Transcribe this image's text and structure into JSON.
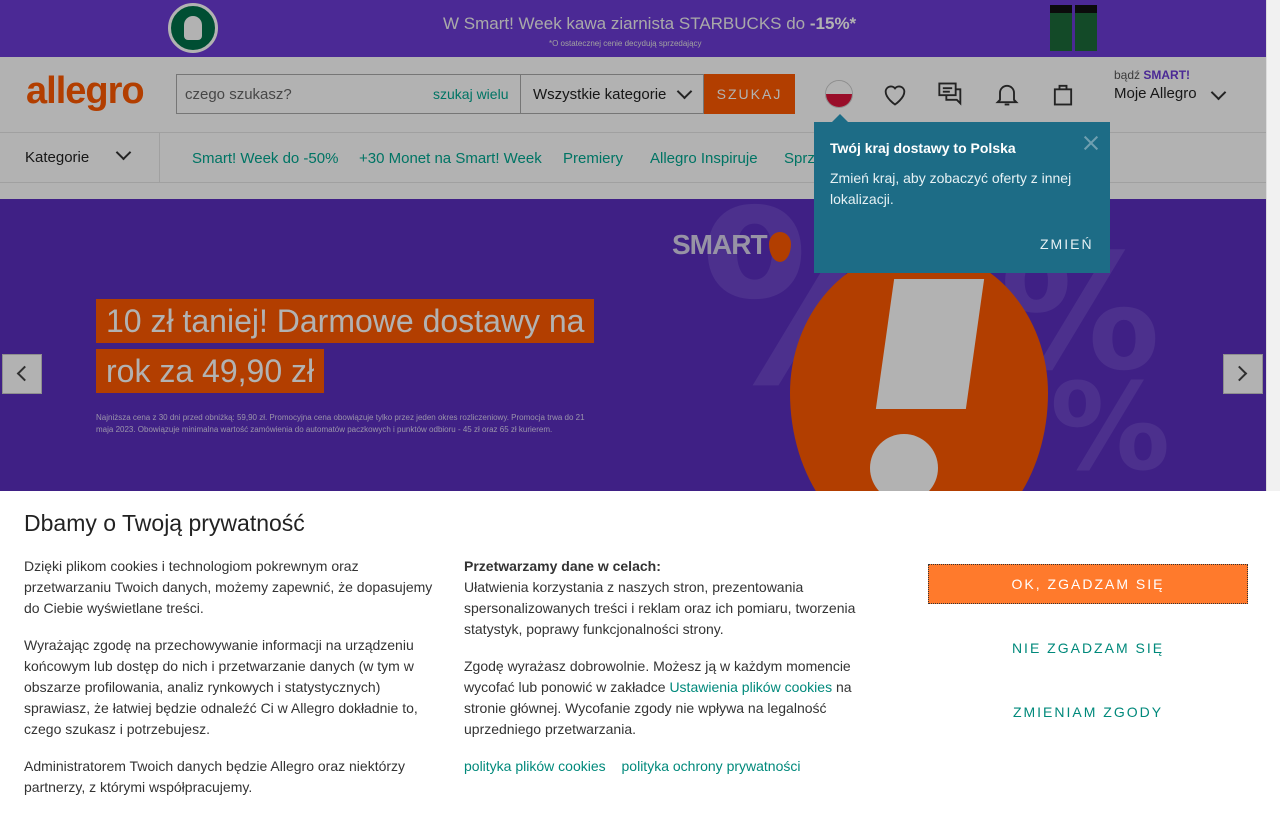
{
  "promo": {
    "title_pre": "W Smart! Week kawa ziarnista STARBUCKS do ",
    "title_discount": "-15%*",
    "subtitle": "*O ostatecznej cenie decydują sprzedający"
  },
  "header": {
    "brand": "allegro",
    "search_placeholder": "czego szukasz?",
    "search_many": "szukaj wielu",
    "category_select": "Wszystkie kategorie",
    "search_button": "SZUKAJ",
    "smart_badge_pre": "bądź ",
    "smart_badge_brand": "SMART!",
    "my_account": "Moje Allegro"
  },
  "nav": {
    "categories_label": "Kategorie",
    "links": [
      "Smart! Week do -50%",
      "+30 Monet na Smart! Week",
      "Premiery",
      "Allegro Inspiruje",
      "Sprz"
    ]
  },
  "hero": {
    "smart_logo": "SMART",
    "title_line1": "10 zł taniej! Darmowe dostawy na",
    "title_line2": "rok za 49,90 zł",
    "note": "Najniższa cena z 30 dni przed obniżką: 59,90 zł. Promocyjna cena obowiązuje tylko przez jeden okres rozliczeniowy. Promocja trwa do 21 maja 2023. Obowiązuje minimalna wartość zamówienia do automatów paczkowych i punktów odbioru - 45 zł oraz 65 zł kurierem.",
    "pct_glyph": "%"
  },
  "country_tip": {
    "title": "Twój kraj dostawy to Polska",
    "text": "Zmień kraj, aby zobaczyć oferty z innej lokalizacji.",
    "button": "ZMIEŃ"
  },
  "cookie": {
    "heading": "Dbamy o Twoją prywatność",
    "col1": [
      "Dzięki plikom cookies i technologiom pokrewnym oraz przetwarzaniu Twoich danych, możemy zapewnić, że dopasujemy do Ciebie wyświetlane treści.",
      "Wyrażając zgodę na przechowywanie informacji na urządzeniu końcowym lub dostęp do nich i przetwarzanie danych (w tym w obszarze profilowania, analiz rynkowych i statystycznych) sprawiasz, że łatwiej będzie odnaleźć Ci w Allegro dokładnie to, czego szukasz i potrzebujesz.",
      "Administratorem Twoich danych będzie Allegro oraz niektórzy partnerzy, z którymi współpracujemy."
    ],
    "col2_heading": "Przetwarzamy dane w celach:",
    "col2_p1": "Ułatwienia korzystania z naszych stron, prezentowania spersonalizowanych treści i reklam oraz ich pomiaru, tworzenia statystyk, poprawy funkcjonalności strony.",
    "col2_p2_pre": "Zgodę wyrażasz dobrowolnie. Możesz ją w każdym momencie wycofać lub ponowić w zakładce ",
    "col2_p2_link": "Ustawienia plików cookies",
    "col2_p2_post": " na stronie głównej. Wycofanie zgody nie wpływa na legalność uprzedniego przetwarzania.",
    "link_cookies": "polityka plików cookies",
    "link_privacy": "polityka ochrony prywatności",
    "btn_ok": "OK, ZGADZAM SIĘ",
    "btn_no": "NIE ZGADZAM SIĘ",
    "btn_change": "ZMIENIAM ZGODY"
  },
  "colors": {
    "brand_orange": "#ff5a00",
    "promo_purple": "#6c3bd6",
    "link_teal": "#00a790",
    "tooltip_blue": "#1d6c86"
  },
  "icons": [
    "starbucks-logo-icon",
    "poland-flag-icon",
    "heart-icon",
    "chat-icon",
    "bell-icon",
    "shopping-bag-icon",
    "chevron-down-icon",
    "chevron-left-icon",
    "chevron-right-icon",
    "close-icon"
  ]
}
